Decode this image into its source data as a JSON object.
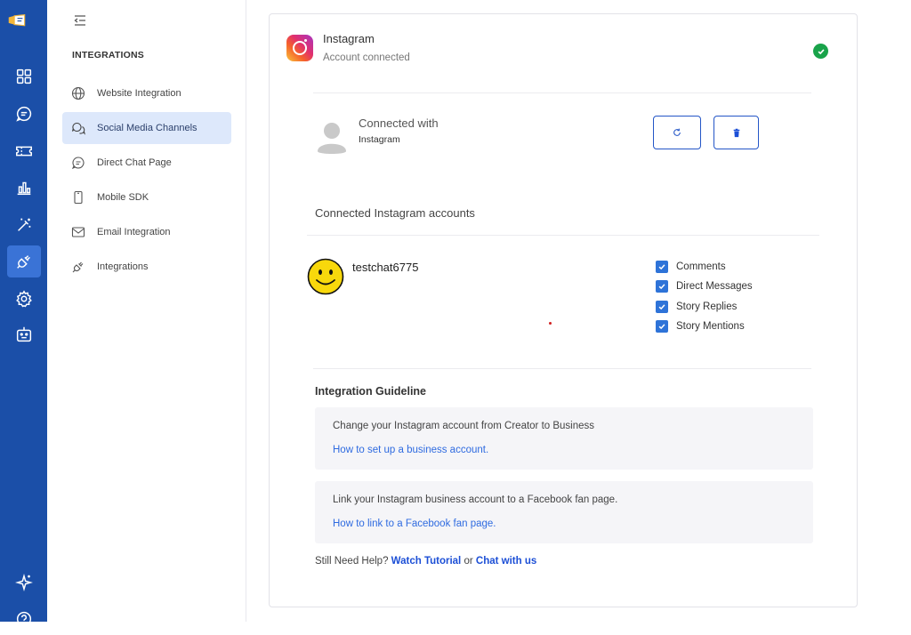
{
  "sidebar": {
    "heading": "INTEGRATIONS",
    "items": [
      {
        "label": "Website Integration",
        "icon": "globe-icon"
      },
      {
        "label": "Social Media Channels",
        "icon": "chat-bubbles-icon"
      },
      {
        "label": "Direct Chat Page",
        "icon": "chat-icon"
      },
      {
        "label": "Mobile SDK",
        "icon": "mobile-icon"
      },
      {
        "label": "Email Integration",
        "icon": "mail-icon"
      },
      {
        "label": "Integrations",
        "icon": "plug-icon"
      }
    ]
  },
  "rail": {
    "icons": [
      "logo-icon",
      "dashboard-icon",
      "chat-icon",
      "ticket-icon",
      "analytics-icon",
      "magic-wand-icon",
      "plug-icon",
      "settings-icon",
      "bot-icon",
      "sparkle-icon",
      "help-icon"
    ]
  },
  "colors": {
    "rail_bg": "#1b4fa8",
    "accent": "#2456c7",
    "success": "#19a34a",
    "nav_active_bg": "#dde8fb"
  },
  "channel": {
    "title": "Instagram",
    "status": "Account connected",
    "connected_with_label": "Connected with",
    "connected_with_value": "Instagram"
  },
  "accounts": {
    "heading": "Connected Instagram accounts",
    "list": [
      {
        "name": "testchat6775",
        "permissions": [
          {
            "label": "Comments",
            "checked": true
          },
          {
            "label": "Direct Messages",
            "checked": true
          },
          {
            "label": "Story Replies",
            "checked": true
          },
          {
            "label": "Story Mentions",
            "checked": true
          }
        ]
      }
    ]
  },
  "guideline": {
    "title": "Integration Guideline",
    "steps": [
      {
        "text": "Change your Instagram account from Creator to Business",
        "link": "How to set up a business account."
      },
      {
        "text": "Link your Instagram business account to a Facebook fan page.",
        "link": "How to link to a Facebook fan page."
      }
    ]
  },
  "help": {
    "prefix": "Still Need Help?",
    "tutorial_link": "Watch Tutorial",
    "or": "or",
    "chat_link": "Chat with us"
  }
}
